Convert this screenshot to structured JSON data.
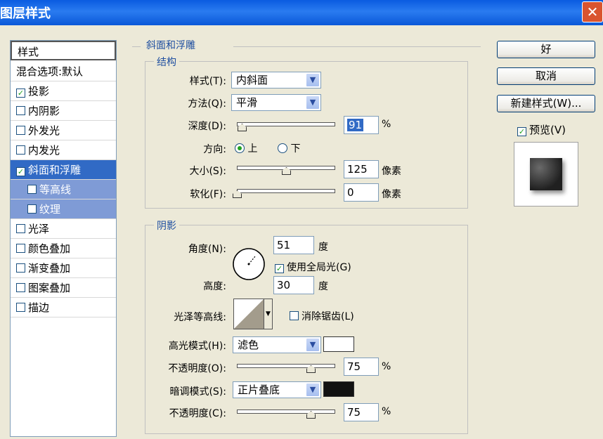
{
  "window": {
    "title": "图层样式",
    "close_glyph": "✕"
  },
  "style_list": {
    "header": "样式",
    "items": [
      {
        "label": "混合选项:默认",
        "checkbox": false,
        "checked": false,
        "selected": false,
        "sub": false
      },
      {
        "label": "投影",
        "checkbox": true,
        "checked": true,
        "selected": false,
        "sub": false
      },
      {
        "label": "内阴影",
        "checkbox": true,
        "checked": false,
        "selected": false,
        "sub": false
      },
      {
        "label": "外发光",
        "checkbox": true,
        "checked": false,
        "selected": false,
        "sub": false
      },
      {
        "label": "内发光",
        "checkbox": true,
        "checked": false,
        "selected": false,
        "sub": false
      },
      {
        "label": "斜面和浮雕",
        "checkbox": true,
        "checked": true,
        "selected": true,
        "sub": false
      },
      {
        "label": "等高线",
        "checkbox": true,
        "checked": false,
        "selected": false,
        "sub": true
      },
      {
        "label": "纹理",
        "checkbox": true,
        "checked": false,
        "selected": false,
        "sub": true
      },
      {
        "label": "光泽",
        "checkbox": true,
        "checked": false,
        "selected": false,
        "sub": false
      },
      {
        "label": "颜色叠加",
        "checkbox": true,
        "checked": false,
        "selected": false,
        "sub": false
      },
      {
        "label": "渐变叠加",
        "checkbox": true,
        "checked": false,
        "selected": false,
        "sub": false
      },
      {
        "label": "图案叠加",
        "checkbox": true,
        "checked": false,
        "selected": false,
        "sub": false
      },
      {
        "label": "描边",
        "checkbox": true,
        "checked": false,
        "selected": false,
        "sub": false
      }
    ]
  },
  "bevel": {
    "legend": "斜面和浮雕",
    "structure": {
      "legend": "结构",
      "style_label": "样式(T):",
      "style_value": "内斜面",
      "technique_label": "方法(Q):",
      "technique_value": "平滑",
      "depth_label": "深度(D):",
      "depth_value": "91",
      "depth_unit": "%",
      "depth_level": 0.05,
      "direction_label": "方向:",
      "dir_up": "上",
      "dir_down": "下",
      "size_label": "大小(S):",
      "size_value": "125",
      "size_unit": "像素",
      "size_level": 0.5,
      "soften_label": "软化(F):",
      "soften_value": "0",
      "soften_unit": "像素",
      "soften_level": 0.0
    },
    "shading": {
      "legend": "阴影",
      "angle_label": "角度(N):",
      "angle_value": "51",
      "angle_unit": "度",
      "global_light_label": "使用全局光(G)",
      "altitude_label": "高度:",
      "altitude_value": "30",
      "altitude_unit": "度",
      "gloss_label": "光泽等高线:",
      "antialias_label": "消除锯齿(L)",
      "highlight_mode_label": "高光模式(H):",
      "highlight_mode_value": "滤色",
      "highlight_color": "#FFFFFF",
      "highlight_opacity_label": "不透明度(O):",
      "highlight_opacity_value": "75",
      "highlight_opacity_unit": "%",
      "highlight_opacity_level": 0.75,
      "shadow_mode_label": "暗调模式(S):",
      "shadow_mode_value": "正片叠底",
      "shadow_color": "#111111",
      "shadow_opacity_label": "不透明度(C):",
      "shadow_opacity_value": "75",
      "shadow_opacity_unit": "%",
      "shadow_opacity_level": 0.75
    }
  },
  "buttons": {
    "ok": "好",
    "cancel": "取消",
    "new_style": "新建样式(W)...",
    "preview": "预览(V)"
  }
}
